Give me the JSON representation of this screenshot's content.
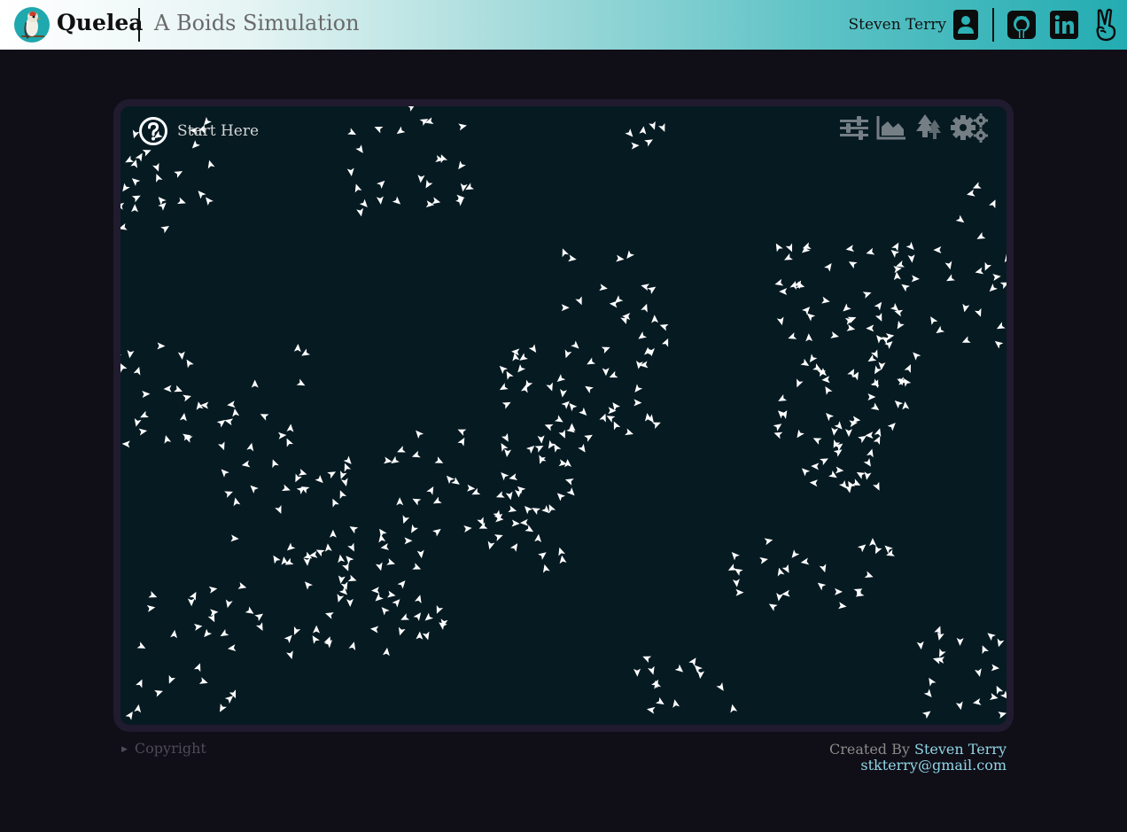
{
  "header": {
    "brand": "Quelea",
    "subtitle": "A Boids Simulation",
    "user_name": "Steven Terry",
    "icons": [
      "bird-logo-icon",
      "contact-card-icon",
      "github-icon",
      "linkedin-icon",
      "peace-hand-icon"
    ]
  },
  "simulation": {
    "start_label": "Start Here",
    "toolbar_icons": [
      "sliders-icon",
      "area-chart-icon",
      "trees-icon",
      "gears-icon"
    ],
    "colors": {
      "background": "#061a22",
      "frame": "#201b2e",
      "boid": "#ffffff"
    }
  },
  "footer": {
    "copyright_label": "Copyright",
    "created_by_label": "Created By",
    "author_link": "Steven Terry",
    "email": "stkterry@gmail.com"
  },
  "colors": {
    "page_background": "#100e17",
    "header_gradient_end": "#22acb1",
    "link": "#8fd6e6"
  }
}
